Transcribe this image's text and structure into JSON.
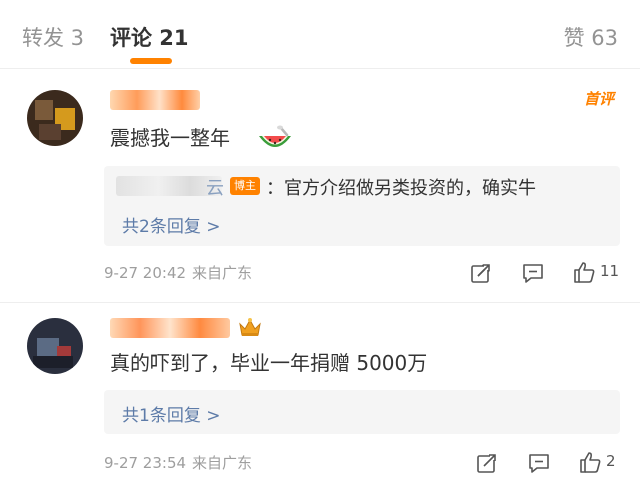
{
  "tabs": {
    "repost": "转发 3",
    "comments": "评论 21",
    "likes": "赞 63"
  },
  "accent_color": "#ff8200",
  "link_color": "#5d7ba8",
  "comments": [
    {
      "hot_tag": "首评",
      "text": "震撼我一整年",
      "emoji": "watermelon-emoji",
      "reply": {
        "author_tail": "云",
        "badge": "博主",
        "text": "：官方介绍做另类投资的，确实牛"
      },
      "more_replies": "共2条回复 >",
      "time": "9-27 20:42",
      "source": "来自广东",
      "likes": "11"
    },
    {
      "badge_icon": "crown-icon",
      "text": "真的吓到了，毕业一年捐赠 5000万",
      "more_replies": "共1条回复 >",
      "time": "9-27 23:54",
      "source": "来自广东",
      "likes": "2"
    }
  ]
}
